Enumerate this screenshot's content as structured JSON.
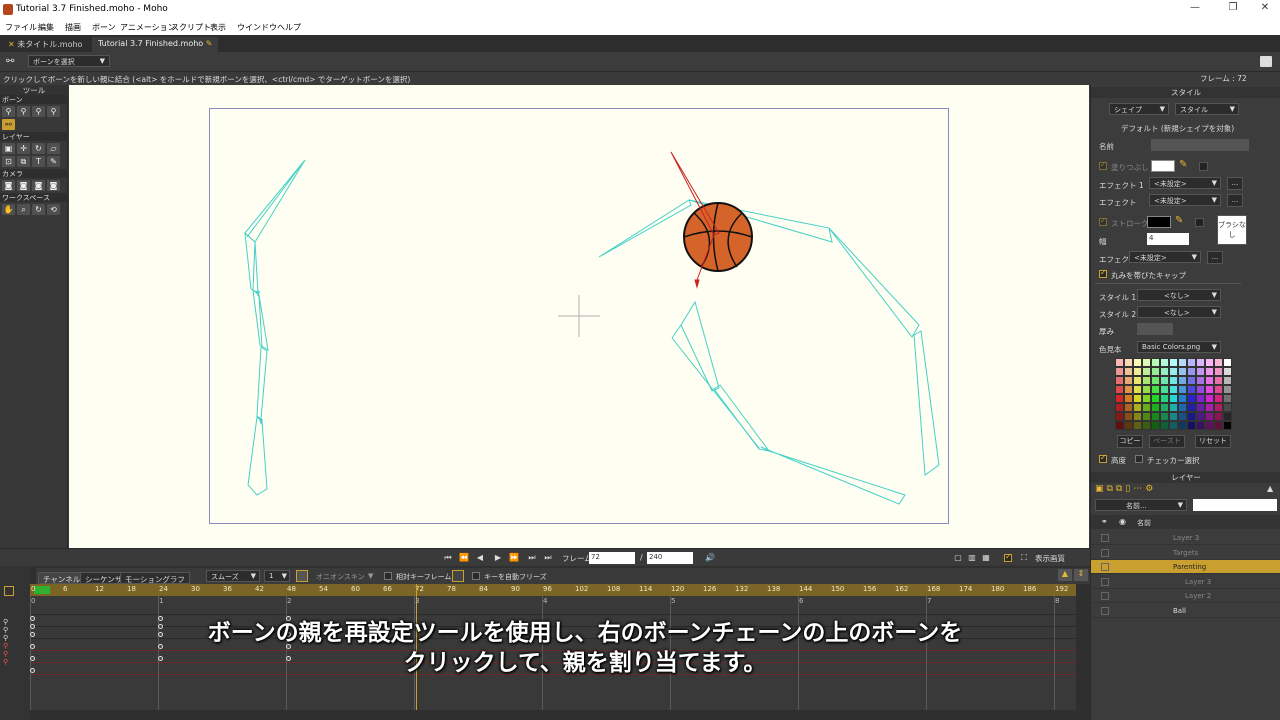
{
  "window": {
    "title": "Tutorial 3.7 Finished.moho - Moho",
    "minimize": "—",
    "maximize": "❐",
    "close": "✕"
  },
  "menu": [
    "ファイル",
    "編集",
    "描画",
    "ボーン",
    "アニメーション",
    "スクリプト",
    "表示",
    "ウインドウ",
    "ヘルプ"
  ],
  "tabs": [
    {
      "label": "未タイトル.moho",
      "active": false
    },
    {
      "label": "Tutorial 3.7 Finished.moho",
      "active": true
    }
  ],
  "tool_options": {
    "mode": "ボーンを選択"
  },
  "hint": "クリックしてボーンを新しい親に結合 (<alt> をホールドで新規ボーンを選択、<ctrl/cmd> でターゲットボーンを選択)",
  "frame_label": "フレーム : 72",
  "tools": {
    "title": "ツール",
    "sections": [
      {
        "name": "ボーン",
        "icons": [
          "bone-select-icon",
          "bone-translate-icon",
          "bone-add-icon",
          "bone-manipulate-icon",
          "bone-reparent-icon"
        ]
      },
      {
        "name": "レイヤー",
        "icons": [
          "layer-set-origin-icon",
          "layer-translate-icon",
          "layer-rotate-icon",
          "layer-shear-icon",
          "layer-scale-icon",
          "layer-flip-icon",
          "text-icon",
          "pencil-icon"
        ]
      },
      {
        "name": "カメラ",
        "icons": [
          "camera-track-icon",
          "camera-zoom-icon",
          "camera-roll-icon",
          "camera-pan-icon"
        ]
      },
      {
        "name": "ワークスペース",
        "icons": [
          "hand-icon",
          "zoom-icon",
          "rotate-icon",
          "orbit-icon"
        ]
      }
    ]
  },
  "transport": {
    "frame_label": "フレーム",
    "frame_value": "72",
    "separator": "/",
    "total": "240",
    "quality": "表示画質"
  },
  "timeline": {
    "tabs": [
      "チャンネル",
      "シーケンサ",
      "モーショングラフ"
    ],
    "interp": "スムーズ",
    "interp_value": "1",
    "onion": "オニオンスキン",
    "relative_keys": "相対キーフレーム",
    "auto_freeze": "キーを自動フリーズ",
    "ruler": [
      "0",
      "6",
      "12",
      "18",
      "24",
      "30",
      "36",
      "42",
      "48",
      "54",
      "60",
      "66",
      "72",
      "78",
      "84",
      "90",
      "96",
      "102",
      "108",
      "114",
      "120",
      "126",
      "132",
      "138",
      "144",
      "150",
      "156",
      "162",
      "168",
      "174",
      "180",
      "186",
      "192"
    ],
    "seconds": [
      "0",
      "1",
      "2",
      "3",
      "4",
      "5",
      "6",
      "7",
      "8"
    ]
  },
  "subtitle": {
    "line1": "ボーンの親を再設定ツールを使用し、右のボーンチェーンの上のボーンを",
    "line2": "クリックして、親を割り当てます。"
  },
  "style_panel": {
    "title": "スタイル",
    "shape_dd": "シェイプ",
    "style_dd": "スタイル",
    "default_label": "デフォルト (新規シェイプを対象)",
    "name_label": "名前",
    "fill_label": "塗りつぶし",
    "effect1_label": "エフェクト 1",
    "effect1_value": "<未設定>",
    "effect2_label": "エフェクト",
    "effect2_value": "<未設定>",
    "stroke_label": "ストローク",
    "brush_label": "ブラシなし",
    "width_label": "幅",
    "width_value": "4",
    "effect3_label": "エフェクト",
    "effect3_value": "<未設定>",
    "round_caps": "丸みを帯びたキャップ",
    "style1_label": "スタイル 1",
    "style1_value": "<なし>",
    "style2_label": "スタイル 2",
    "style2_value": "<なし>",
    "thickness_label": "厚み",
    "palette_label": "色見本",
    "palette_value": "Basic Colors.png",
    "copy_btn": "コピー",
    "paste_btn": "ペースト",
    "reset_btn": "リセット",
    "advanced": "高度",
    "checker": "チェッカー選択",
    "fill_color": "#ffffff",
    "stroke_color": "#000000"
  },
  "layers_panel": {
    "title": "レイヤー",
    "name_dd": "名前...",
    "header_name": "名前",
    "layers": [
      {
        "name": "Layer 3",
        "indent": 0,
        "selected": false,
        "dim": true
      },
      {
        "name": "Targets",
        "indent": 0,
        "selected": false,
        "dim": true
      },
      {
        "name": "Parenting",
        "indent": 0,
        "selected": true,
        "dim": false
      },
      {
        "name": "Layer 3",
        "indent": 1,
        "selected": false,
        "dim": true
      },
      {
        "name": "Layer 2",
        "indent": 1,
        "selected": false,
        "dim": true
      },
      {
        "name": "Ball",
        "indent": 0,
        "selected": false,
        "dim": false
      }
    ]
  },
  "colors": {
    "accent": "#c9a030",
    "bone": "#45d0c8",
    "ball": "#d4642a",
    "ruler": "#7a6526"
  }
}
